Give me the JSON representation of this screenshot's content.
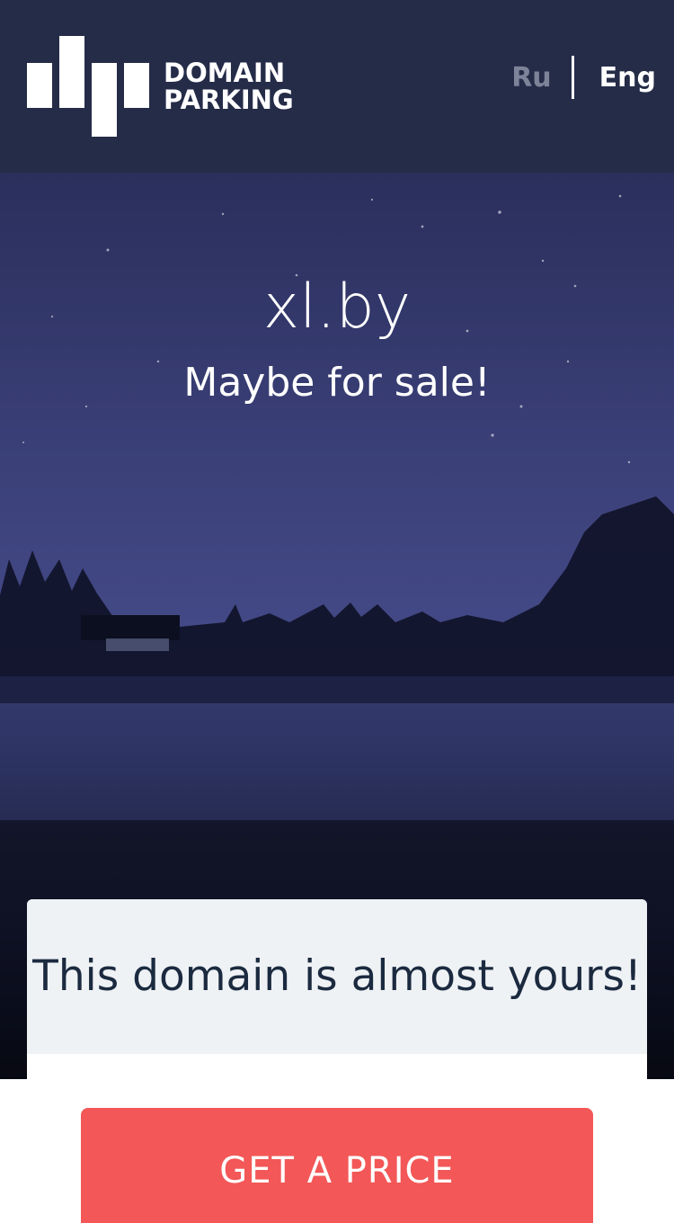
{
  "header": {
    "logo_line1": "DOMAIN",
    "logo_line2": "PARKING",
    "lang_ru": "Ru",
    "lang_eng": "Eng"
  },
  "hero": {
    "domain": "xl.by",
    "subtitle": "Maybe for sale!"
  },
  "card": {
    "title": "This domain is almost yours!",
    "button_label": "GET A PRICE"
  },
  "colors": {
    "header_bg": "#252c48",
    "button_bg": "#f35757",
    "card_head_bg": "#eff2f5",
    "lang_inactive": "#7d8499"
  }
}
